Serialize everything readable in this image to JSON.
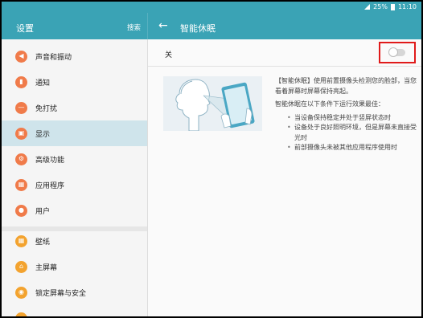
{
  "status_bar": {
    "battery": "25%",
    "time": "11:10"
  },
  "app_bar": {
    "left_title": "设置",
    "search_label": "搜索",
    "right_title": "智能休眠"
  },
  "sidebar": {
    "items": [
      {
        "label": "声音和振动",
        "icon": "volume-icon",
        "color": "#f07b4a"
      },
      {
        "label": "通知",
        "icon": "notification-icon",
        "color": "#f07b4a"
      },
      {
        "label": "免打扰",
        "icon": "do-not-disturb-icon",
        "color": "#f07b4a"
      },
      {
        "label": "显示",
        "icon": "display-icon",
        "color": "#f07b4a"
      },
      {
        "label": "高级功能",
        "icon": "advanced-features-icon",
        "color": "#f07b4a"
      },
      {
        "label": "应用程序",
        "icon": "applications-icon",
        "color": "#f07b4a"
      },
      {
        "label": "用户",
        "icon": "users-icon",
        "color": "#f07b4a"
      },
      {
        "label": "壁纸",
        "icon": "wallpaper-icon",
        "color": "#f3a32f"
      },
      {
        "label": "主屏幕",
        "icon": "home-screen-icon",
        "color": "#f3a32f"
      },
      {
        "label": "锁定屏幕与安全",
        "icon": "lock-icon",
        "color": "#f3a32f"
      }
    ]
  },
  "content": {
    "toggle_label": "关",
    "toggle_on": false,
    "description": "【智能休眠】使用前置摄像头检测您的脸部，当您看着屏幕时屏幕保持亮起。",
    "conditions_title": "智能休眠在以下条件下运行效果最佳：",
    "conditions": [
      "当设备保持稳定并处于竖屏状态时",
      "设备处于良好照明环境，但是屏幕未直接受光时",
      "前部摄像头未被其他应用程序使用时"
    ]
  }
}
